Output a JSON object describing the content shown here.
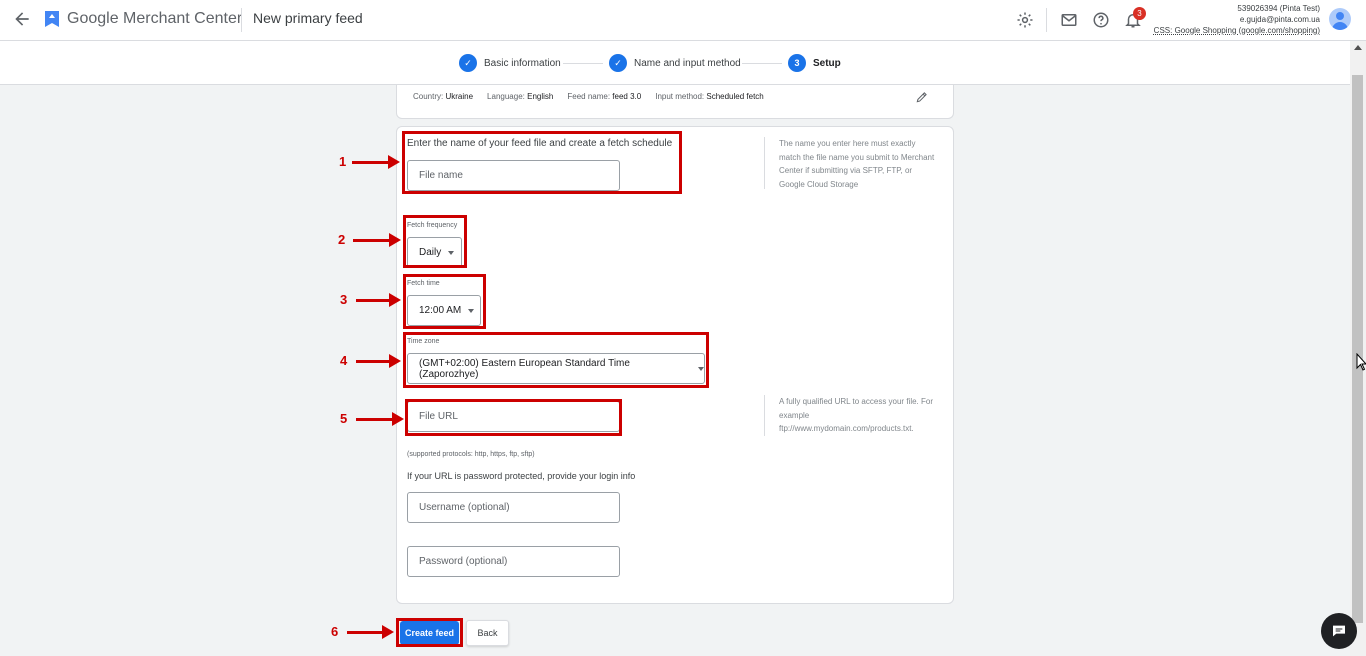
{
  "header": {
    "brand": "Google Merchant Center",
    "page_title": "New primary feed",
    "notification_count": "3",
    "account_id": "539026394 (Pinta Test)",
    "account_email": "e.gujda@pinta.com.ua",
    "account_css": "CSS: Google Shopping (google.com/shopping)"
  },
  "stepper": {
    "steps": [
      {
        "label": "Basic information",
        "state": "done"
      },
      {
        "label": "Name and input method",
        "state": "done"
      },
      {
        "label": "Setup",
        "number": "3",
        "state": "active"
      }
    ]
  },
  "summary": {
    "country_label": "Country:",
    "country": "Ukraine",
    "language_label": "Language:",
    "language": "English",
    "feed_name_label": "Feed name:",
    "feed_name": "feed 3.0",
    "input_method_label": "Input method:",
    "input_method": "Scheduled fetch"
  },
  "form": {
    "intro": "Enter the name of your feed file and create a fetch schedule",
    "file_name_placeholder": "File name",
    "file_name_hint": "The name you enter here must exactly match the file name you submit to Merchant Center if submitting via SFTP, FTP, or Google Cloud Storage",
    "fetch_frequency_label": "Fetch frequency",
    "fetch_frequency_value": "Daily",
    "fetch_time_label": "Fetch time",
    "fetch_time_value": "12:00 AM",
    "time_zone_label": "Time zone",
    "time_zone_value": "(GMT+02:00) Eastern European Standard Time (Zaporozhye)",
    "file_url_placeholder": "File URL",
    "file_url_hint": "A fully qualified URL to access your file. For example ftp://www.mydomain.com/products.txt.",
    "protocols_note": "(supported protocols: http, https, ftp, sftp)",
    "password_prompt": "If your URL is password protected, provide your login info",
    "username_placeholder": "Username (optional)",
    "password_placeholder": "Password (optional)"
  },
  "actions": {
    "create_label": "Create feed",
    "back_label": "Back"
  },
  "annotations": [
    "1",
    "2",
    "3",
    "4",
    "5",
    "6"
  ],
  "colors": {
    "accent": "#1a73e8",
    "annotation": "#cc0000",
    "badge": "#d93025"
  }
}
